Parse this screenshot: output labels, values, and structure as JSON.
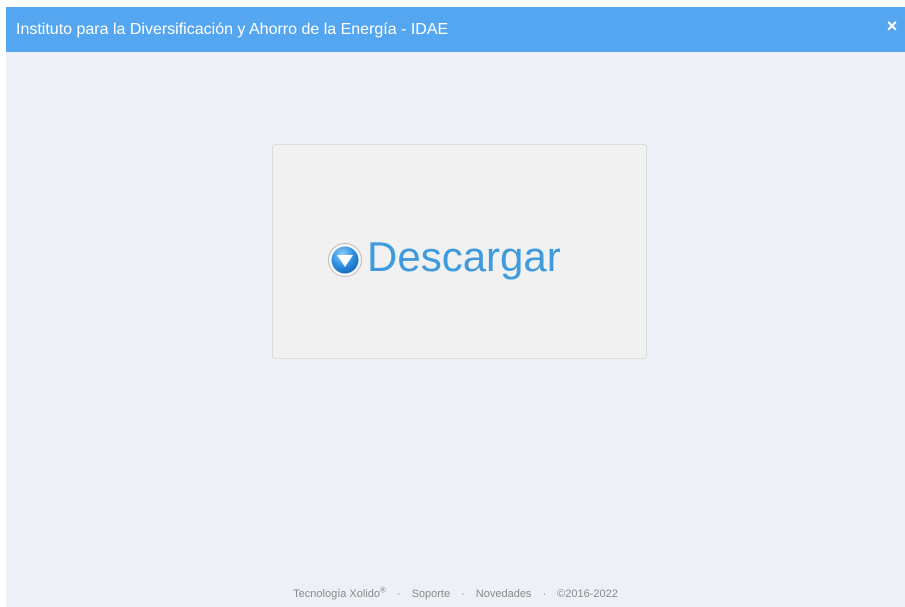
{
  "window": {
    "title": "Instituto para la Diversificación y Ahorro de la Energía - IDAE",
    "close_glyph": "×",
    "close_icon": "close-icon"
  },
  "download": {
    "label": "Descargar",
    "icon": "download-arrow-circle-icon"
  },
  "footer": {
    "brand": "Tecnología Xolido",
    "brand_mark": "®",
    "separator": "·",
    "support": "Soporte",
    "news": "Novedades",
    "copyright": "©2016-2022"
  },
  "colors": {
    "titlebar": "#55a6f0",
    "background": "#eef0f7",
    "card": "#f1f1f1",
    "accent": "#3f9bdc",
    "footer_text": "#8a8a8a"
  }
}
